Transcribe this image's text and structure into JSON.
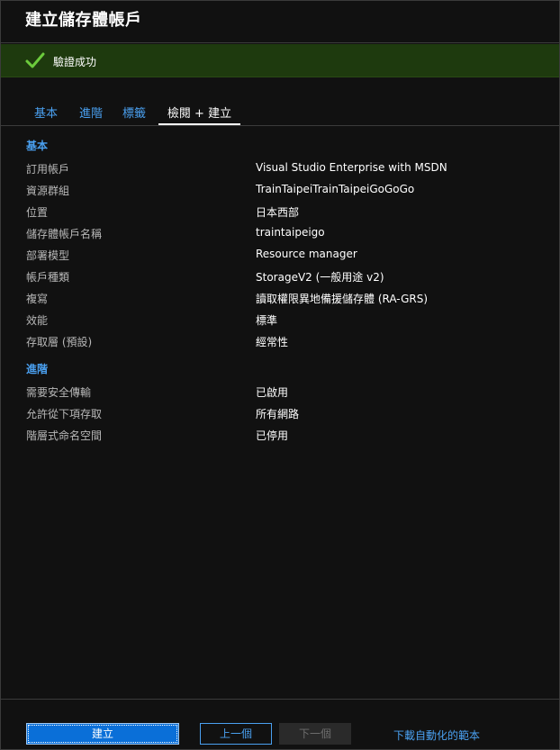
{
  "header": {
    "title": "建立儲存體帳戶"
  },
  "banner": {
    "icon": "checkmark-icon",
    "text": "驗證成功",
    "color": "#1e3a0e"
  },
  "tabs": [
    {
      "label": "基本",
      "active": false
    },
    {
      "label": "進階",
      "active": false
    },
    {
      "label": "標籤",
      "active": false
    },
    {
      "label": "檢閱 + 建立",
      "active": true
    }
  ],
  "sections": {
    "basics": {
      "heading": "基本",
      "rows": [
        {
          "label": "訂用帳戶",
          "value": "Visual Studio Enterprise with MSDN"
        },
        {
          "label": "資源群組",
          "value": "TrainTaipeiTrainTaipeiGoGoGo"
        },
        {
          "label": "位置",
          "value": "日本西部"
        },
        {
          "label": "儲存體帳戶名稱",
          "value": "traintaipeigo"
        },
        {
          "label": "部署模型",
          "value": "Resource manager"
        },
        {
          "label": "帳戶種類",
          "value": "StorageV2 (一般用途 v2)"
        },
        {
          "label": "複寫",
          "value": "讀取權限異地備援儲存體 (RA-GRS)"
        },
        {
          "label": "效能",
          "value": "標準"
        },
        {
          "label": "存取層 (預設)",
          "value": "經常性"
        }
      ]
    },
    "advanced": {
      "heading": "進階",
      "rows": [
        {
          "label": "需要安全傳輸",
          "value": "已啟用"
        },
        {
          "label": "允許從下項存取",
          "value": "所有網路"
        },
        {
          "label": "階層式命名空間",
          "value": "已停用"
        }
      ]
    }
  },
  "footer": {
    "create_label": "建立",
    "prev_label": "上一個",
    "next_label": "下一個",
    "template_link": "下載自動化的範本"
  },
  "colors": {
    "accent": "#4aa0f0",
    "primary_button": "#0a6fd8",
    "success": "#1e3a0e"
  }
}
